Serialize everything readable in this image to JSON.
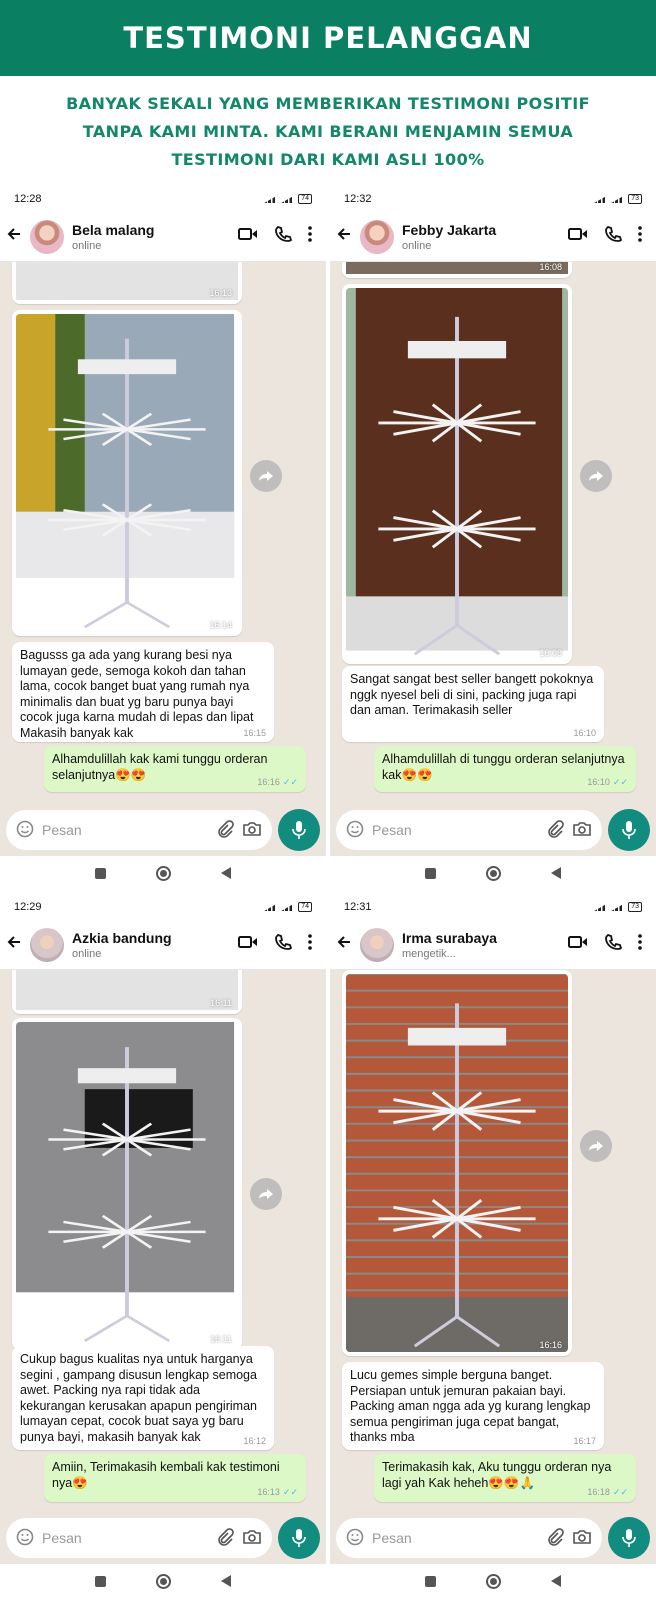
{
  "header": {
    "title": "TESTIMONI PELANGGAN"
  },
  "intro": {
    "lines": [
      "BANYAK SEKALI YANG MEMBERIKAN TESTIMONI POSITIF",
      "TANPA KAMI MINTA. KAMI BERANI MENJAMIN SEMUA",
      "TESTIMONI DARI KAMI ASLI 100%"
    ]
  },
  "colors": {
    "brand_green": "#0b7f62",
    "heading_green": "#13876a",
    "chat_bg": "#ece5dd",
    "outgoing_bubble": "#dcf8c6",
    "whatsapp_teal": "#118c7e",
    "read_ticks": "#4fb6ec"
  },
  "icons": [
    "back-arrow-icon",
    "video-call-icon",
    "phone-icon",
    "more-options-icon",
    "forward-icon",
    "emoji-icon",
    "attachment-icon",
    "camera-icon",
    "microphone-icon",
    "nav-recents-icon",
    "nav-home-icon",
    "nav-back-icon"
  ],
  "chats": [
    {
      "status_time": "12:28",
      "battery": "74",
      "contact_name": "Bela malang",
      "contact_status": "online",
      "prev_photo_time": "16:13",
      "photo_time": "16:14",
      "incoming_text": "Bagusss ga ada yang kurang besi nya lumayan gede, semoga kokoh dan tahan lama, cocok banget buat yang rumah nya minimalis dan buat yg baru punya bayi cocok juga karna mudah di lepas dan lipat Makasih banyak kak",
      "incoming_time": "16:15",
      "outgoing_text": "Alhamdulillah kak kami tunggu orderan selanjutnya😍😍",
      "outgoing_time": "16:16",
      "input_placeholder": "Pesan"
    },
    {
      "status_time": "12:32",
      "battery": "73",
      "contact_name": "Febby Jakarta",
      "contact_status": "online",
      "prev_photo_time": "16:08",
      "photo_time": "16:08",
      "incoming_text": "Sangat sangat best seller bangett pokoknya nggk nyesel beli di sini, packing juga rapi dan aman. Terimakasih seller",
      "incoming_time": "16:10",
      "outgoing_text": "Alhamdulillah di tunggu orderan selanjutnya kak😍😍",
      "outgoing_time": "16:10",
      "input_placeholder": "Pesan"
    },
    {
      "status_time": "12:29",
      "battery": "74",
      "contact_name": "Azkia bandung",
      "contact_status": "online",
      "prev_photo_time": "16:11",
      "photo_time": "16:11",
      "incoming_text": "Cukup bagus kualitas nya untuk harganya segini , gampang disusun lengkap semoga awet. Packing nya rapi tidak ada kekurangan kerusakan apapun pengiriman lumayan cepat, cocok buat saya yg baru punya bayi, makasih banyak kak",
      "incoming_time": "16:12",
      "outgoing_text": "Amiin, Terimakasih kembali kak testimoni nya😍",
      "outgoing_time": "16:13",
      "input_placeholder": "Pesan"
    },
    {
      "status_time": "12:31",
      "battery": "73",
      "contact_name": "Irma surabaya",
      "contact_status": "mengetik...",
      "prev_photo_time": "",
      "photo_time": "16:16",
      "incoming_text": "Lucu gemes simple berguna banget. Persiapan untuk jemuran pakaian bayi. Packing aman ngga ada yg kurang lengkap semua pengiriman juga cepat bangat, thanks mba",
      "incoming_time": "16:17",
      "outgoing_text": "Terimakasih kak, Aku tunggu orderan nya lagi yah Kak heheh😍😍🙏",
      "outgoing_time": "16:18",
      "input_placeholder": "Pesan"
    }
  ]
}
